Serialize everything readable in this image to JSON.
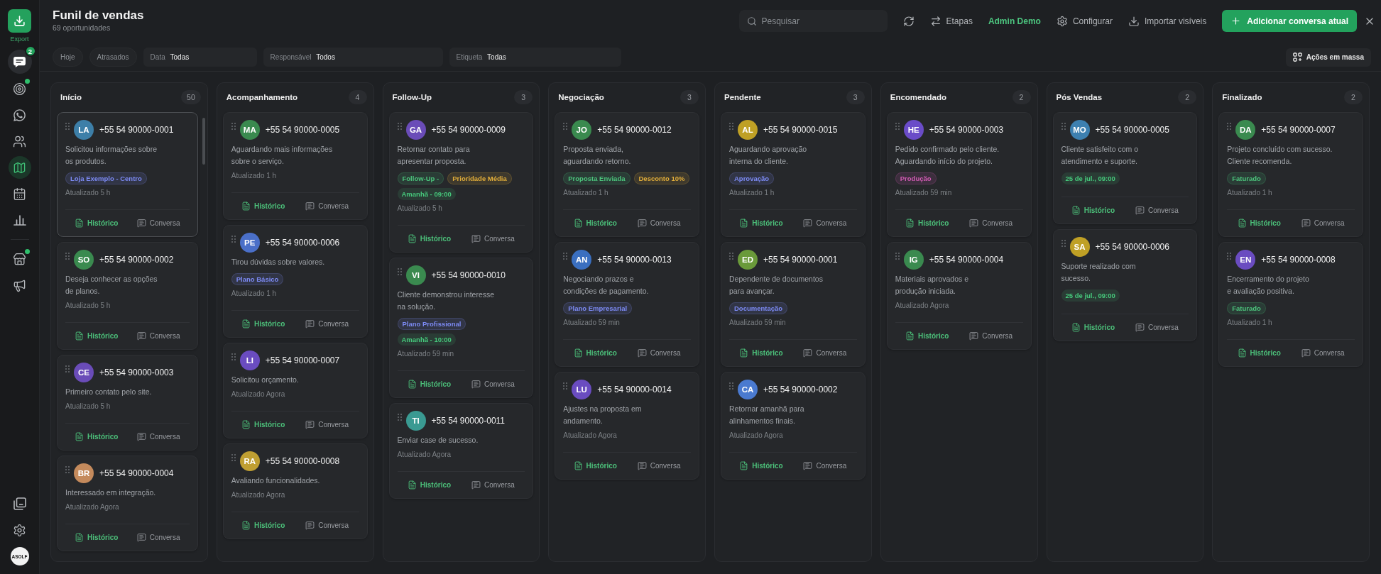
{
  "sidebar": {
    "export_button": {
      "label": "Export"
    },
    "chat_button": {
      "badge": "2"
    },
    "primary_items": [
      {
        "selected": false,
        "notification_dot": true
      },
      {
        "selected": false,
        "notification_dot": false
      },
      {
        "selected": false,
        "notification_dot": false
      },
      {
        "selected": true,
        "notification_dot": false
      },
      {
        "selected": false,
        "notification_dot": false
      },
      {
        "selected": false,
        "notification_dot": false
      }
    ],
    "secondary_items": [
      {
        "selected": false,
        "notification_dot": true
      },
      {
        "selected": false,
        "notification_dot": false
      }
    ],
    "logo": "ASOLF"
  },
  "header": {
    "title": "Funil de vendas",
    "subtitle": "69 oportunidades"
  },
  "toolbar": {
    "search": {
      "placeholder": "Pesquisar"
    },
    "items": [
      {
        "kind": "icon-button"
      },
      {
        "kind": "button",
        "label": "Etapas"
      },
      {
        "kind": "link",
        "label": "Admin Demo"
      },
      {
        "kind": "button",
        "label": "Configurar"
      },
      {
        "kind": "button",
        "label": "Importar visíveis"
      },
      {
        "kind": "primary",
        "label": "Adicionar conversa atual"
      },
      {
        "kind": "icon-button"
      }
    ]
  },
  "filters": [
    {
      "kind": "chip",
      "label": "Hoje",
      "selected": false
    },
    {
      "kind": "chip",
      "label": "Atrasados",
      "selected": false
    },
    {
      "kind": "select",
      "label": "Data",
      "value": "Todas"
    },
    {
      "kind": "select",
      "label": "Responsável",
      "value": "Todos"
    },
    {
      "kind": "select",
      "label": "Etiqueta",
      "value": "Todas"
    }
  ],
  "bulk_action": {
    "label": "Ações em massa"
  },
  "columns": [
    {
      "title": "Início",
      "count": "50",
      "cards": [
        {
          "initials": "LA",
          "color": "#3d7fa8",
          "phone": "+55 54 90000-0001",
          "note": "Solicitou informações sobre\nos produtos.",
          "tags": [
            {
              "label": "Loja Exemplo - Centro",
              "color": "#7d8bf5"
            }
          ],
          "updated": "Atualizado 5 h",
          "selected": true,
          "history_label": "Histórico",
          "chat_label": "Conversa"
        },
        {
          "initials": "SO",
          "color": "#3a8a4f",
          "phone": "+55 54 90000-0002",
          "note": "Deseja conhecer as opções\nde planos.",
          "updated": "Atualizado 5 h",
          "selected": false,
          "history_label": "Histórico",
          "chat_label": "Conversa"
        },
        {
          "initials": "CE",
          "color": "#6a4cb8",
          "phone": "+55 54 90000-0003",
          "note": "Primeiro contato pelo site.",
          "updated": "Atualizado 5 h",
          "selected": false,
          "history_label": "Histórico",
          "chat_label": "Conversa"
        },
        {
          "initials": "BR",
          "color": "#c48a5c",
          "phone": "+55 54 90000-0004",
          "note": "Interessado em integração.",
          "updated": "Atualizado Agora",
          "selected": false,
          "history_label": "Histórico",
          "chat_label": "Conversa"
        }
      ]
    },
    {
      "title": "Acompanhamento",
      "count": "4",
      "cards": [
        {
          "initials": "MA",
          "color": "#3a8a4f",
          "phone": "+55 54 90000-0005",
          "note": "Aguardando mais informações\nsobre o serviço.",
          "updated": "Atualizado 1 h",
          "selected": false,
          "history_label": "Histórico",
          "chat_label": "Conversa"
        },
        {
          "initials": "PE",
          "color": "#4a6fc8",
          "phone": "+55 54 90000-0006",
          "note": "Tirou dúvidas sobre valores.",
          "tags": [
            {
              "label": "Plano Básico",
              "color": "#7d8bf5"
            }
          ],
          "updated": "Atualizado 1 h",
          "selected": false,
          "history_label": "Histórico",
          "chat_label": "Conversa"
        },
        {
          "initials": "LI",
          "color": "#6a4cc0",
          "phone": "+55 54 90000-0007",
          "note": "Solicitou orçamento.",
          "updated": "Atualizado Agora",
          "selected": false,
          "history_label": "Histórico",
          "chat_label": "Conversa"
        },
        {
          "initials": "RA",
          "color": "#bf9f32",
          "phone": "+55 54 90000-0008",
          "note": "Avaliando funcionalidades.",
          "updated": "Atualizado Agora",
          "selected": false,
          "history_label": "Histórico",
          "chat_label": "Conversa"
        }
      ]
    },
    {
      "title": "Follow-Up",
      "count": "3",
      "cards": [
        {
          "initials": "GA",
          "color": "#6a4cb8",
          "phone": "+55 54 90000-0009",
          "note": "Retornar contato para\napresentar proposta.",
          "tags": [
            {
              "label": "Follow-Up -",
              "color": "#4cc47c"
            },
            {
              "label": "Prioridade Média",
              "color": "#e0ad3a"
            }
          ],
          "reminder": "Amanhã - 09:00",
          "updated": "Atualizado 5 h",
          "selected": false,
          "history_label": "Histórico",
          "chat_label": "Conversa"
        },
        {
          "initials": "VI",
          "color": "#3a8a4f",
          "phone": "+55 54 90000-0010",
          "note": "Cliente demonstrou interesse\nna solução.",
          "tags": [
            {
              "label": "Plano Profissional",
              "color": "#7d8bf5"
            }
          ],
          "reminder": "Amanhã - 10:00",
          "updated": "Atualizado 59 min",
          "selected": false,
          "history_label": "Histórico",
          "chat_label": "Conversa"
        },
        {
          "initials": "TI",
          "color": "#3a9a92",
          "phone": "+55 54 90000-0011",
          "note": "Enviar case de sucesso.",
          "updated": "Atualizado Agora",
          "selected": false,
          "history_label": "Histórico",
          "chat_label": "Conversa"
        }
      ]
    },
    {
      "title": "Negociação",
      "count": "3",
      "cards": [
        {
          "initials": "JO",
          "color": "#3a8a4f",
          "phone": "+55 54 90000-0012",
          "note": "Proposta enviada,\naguardando retorno.",
          "tags": [
            {
              "label": "Proposta Enviada",
              "color": "#4cc47c"
            },
            {
              "label": "Desconto 10%",
              "color": "#e0ad3a"
            }
          ],
          "updated": "Atualizado 1 h",
          "selected": false,
          "history_label": "Histórico",
          "chat_label": "Conversa"
        },
        {
          "initials": "AN",
          "color": "#3a6fc0",
          "phone": "+55 54 90000-0013",
          "note": "Negociando prazos e\ncondições de pagamento.",
          "tags": [
            {
              "label": "Plano Empresarial",
              "color": "#7d8bf5"
            }
          ],
          "updated": "Atualizado 59 min",
          "selected": false,
          "history_label": "Histórico",
          "chat_label": "Conversa"
        },
        {
          "initials": "LU",
          "color": "#6a4cc0",
          "phone": "+55 54 90000-0014",
          "note": "Ajustes na proposta em\nandamento.",
          "updated": "Atualizado Agora",
          "selected": false,
          "history_label": "Histórico",
          "chat_label": "Conversa"
        }
      ]
    },
    {
      "title": "Pendente",
      "count": "3",
      "cards": [
        {
          "initials": "AL",
          "color": "#bfa025",
          "phone": "+55 54 90000-0015",
          "note": "Aguardando aprovação\ninterna do cliente.",
          "tags": [
            {
              "label": "Aprovação",
              "color": "#7d8bf5"
            }
          ],
          "updated": "Atualizado 1 h",
          "selected": false,
          "history_label": "Histórico",
          "chat_label": "Conversa"
        },
        {
          "initials": "ED",
          "color": "#6a9a3a",
          "phone": "+55 54 90000-0001",
          "note": "Dependente de documentos\npara avançar.",
          "tags": [
            {
              "label": "Documentação",
              "color": "#7d8bf5"
            }
          ],
          "updated": "Atualizado 59 min",
          "selected": false,
          "history_label": "Histórico",
          "chat_label": "Conversa"
        },
        {
          "initials": "CA",
          "color": "#4a7ad0",
          "phone": "+55 54 90000-0002",
          "note": "Retornar amanhã para\nalinhamentos finais.",
          "updated": "Atualizado Agora",
          "selected": false,
          "history_label": "Histórico",
          "chat_label": "Conversa"
        }
      ]
    },
    {
      "title": "Encomendado",
      "count": "2",
      "cards": [
        {
          "initials": "HE",
          "color": "#6a4cc8",
          "phone": "+55 54 90000-0003",
          "note": "Pedido confirmado pelo cliente.\nAguardando início do projeto.",
          "tags": [
            {
              "label": "Produção",
              "color": "#d15bb3"
            }
          ],
          "updated": "Atualizado 59 min",
          "selected": false,
          "history_label": "Histórico",
          "chat_label": "Conversa"
        },
        {
          "initials": "IG",
          "color": "#3a8a4f",
          "phone": "+55 54 90000-0004",
          "note": "Materiais aprovados e\nprodução iniciada.",
          "updated": "Atualizado Agora",
          "selected": false,
          "history_label": "Histórico",
          "chat_label": "Conversa"
        }
      ]
    },
    {
      "title": "Pós Vendas",
      "count": "2",
      "cards": [
        {
          "initials": "MO",
          "color": "#3d80b0",
          "phone": "+55 54 90000-0005",
          "note": "Cliente satisfeito com o\natendimento e suporte.",
          "reminder": "25 de jul., 09:00",
          "selected": false,
          "history_label": "Histórico",
          "chat_label": "Conversa"
        },
        {
          "initials": "SA",
          "color": "#bfa025",
          "phone": "+55 54 90000-0006",
          "note": "Suporte realizado com\nsucesso.",
          "reminder": "25 de jul., 09:00",
          "selected": false,
          "history_label": "Histórico",
          "chat_label": "Conversa"
        }
      ]
    },
    {
      "title": "Finalizado",
      "count": "2",
      "cards": [
        {
          "initials": "DA",
          "color": "#3a8a4f",
          "phone": "+55 54 90000-0007",
          "note": "Projeto concluído com sucesso.\nCliente recomenda.",
          "tags": [
            {
              "label": "Faturado",
              "color": "#4cc47c"
            }
          ],
          "updated": "Atualizado 1 h",
          "selected": false,
          "history_label": "Histórico",
          "chat_label": "Conversa"
        },
        {
          "initials": "EN",
          "color": "#6a4cc0",
          "phone": "+55 54 90000-0008",
          "note": "Encerramento do projeto\ne avaliação positiva.",
          "tags": [
            {
              "label": "Faturado",
              "color": "#4cc47c"
            }
          ],
          "updated": "Atualizado 1 h",
          "selected": false,
          "history_label": "Histórico",
          "chat_label": "Conversa"
        }
      ]
    }
  ]
}
